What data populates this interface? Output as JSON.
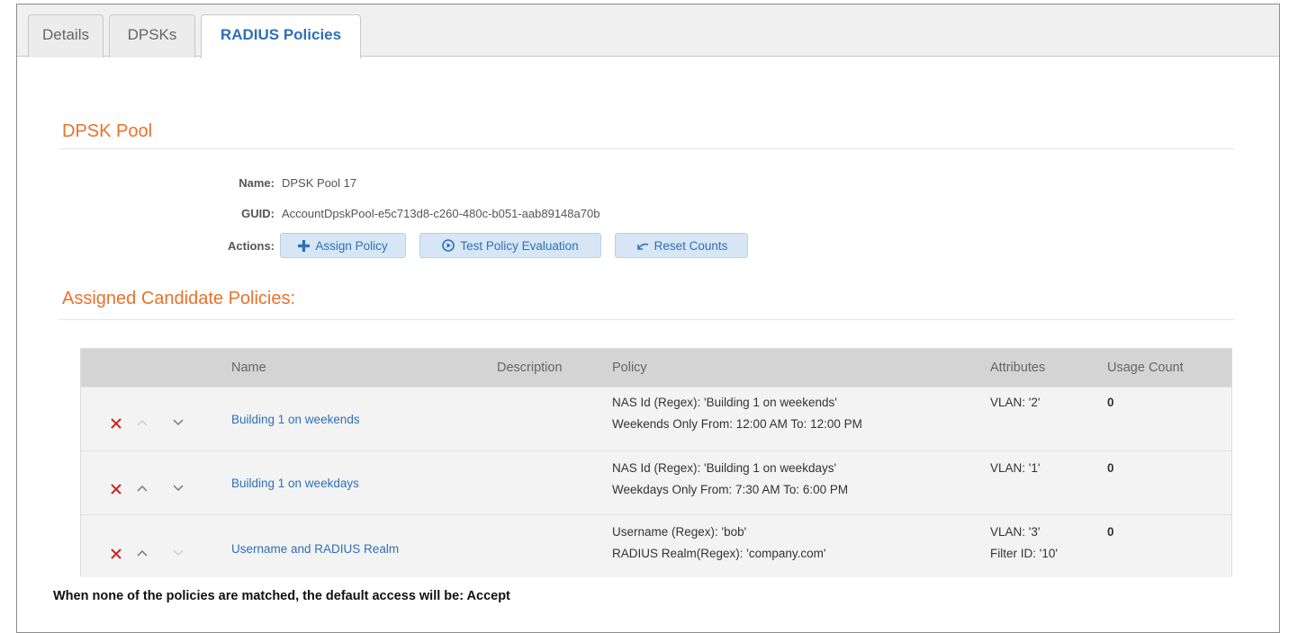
{
  "tabs": [
    {
      "label": "Details"
    },
    {
      "label": "DPSKs"
    },
    {
      "label": "RADIUS Policies"
    }
  ],
  "pool": {
    "title": "DPSK Pool",
    "name_label": "Name:",
    "name_value": "DPSK Pool 17",
    "guid_label": "GUID:",
    "guid_value": "AccountDpskPool-e5c713d8-c260-480c-b051-aab89148a70b",
    "actions_label": "Actions:"
  },
  "actions": {
    "assign": "Assign Policy",
    "test": "Test Policy Evaluation",
    "reset": "Reset Counts"
  },
  "assigned_title": "Assigned Candidate Policies:",
  "table": {
    "columns": [
      "Name",
      "Description",
      "Policy",
      "Attributes",
      "Usage Count"
    ],
    "rows": [
      {
        "name": "Building 1 on weekends",
        "description": "",
        "policy_line1": "NAS Id (Regex): 'Building 1 on weekends'",
        "policy_line2": "Weekends Only From: 12:00 AM To: 12:00 PM",
        "attr_line1": "VLAN: '2'",
        "attr_line2": "",
        "usage": "0"
      },
      {
        "name": "Building 1 on weekdays",
        "description": "",
        "policy_line1": "NAS Id (Regex): 'Building 1 on weekdays'",
        "policy_line2": "Weekdays Only From: 7:30 AM To: 6:00 PM",
        "attr_line1": "VLAN: '1'",
        "attr_line2": "",
        "usage": "0"
      },
      {
        "name": "Username and RADIUS Realm",
        "description": "",
        "policy_line1": "Username (Regex): 'bob'",
        "policy_line2": "RADIUS Realm(Regex): 'company.com'",
        "attr_line1": "VLAN: '3'",
        "attr_line2": "Filter ID: '10'",
        "usage": "0"
      }
    ]
  },
  "footer": "When none of the policies are matched, the default access will be: Accept",
  "colors": {
    "accent_orange": "#e8722b",
    "link_blue": "#2f6fb8",
    "delete_red": "#cc2222"
  },
  "icons": [
    "plus-icon",
    "play-circle-icon",
    "undo-icon",
    "delete-x-icon",
    "move-up-icon",
    "move-down-icon"
  ]
}
